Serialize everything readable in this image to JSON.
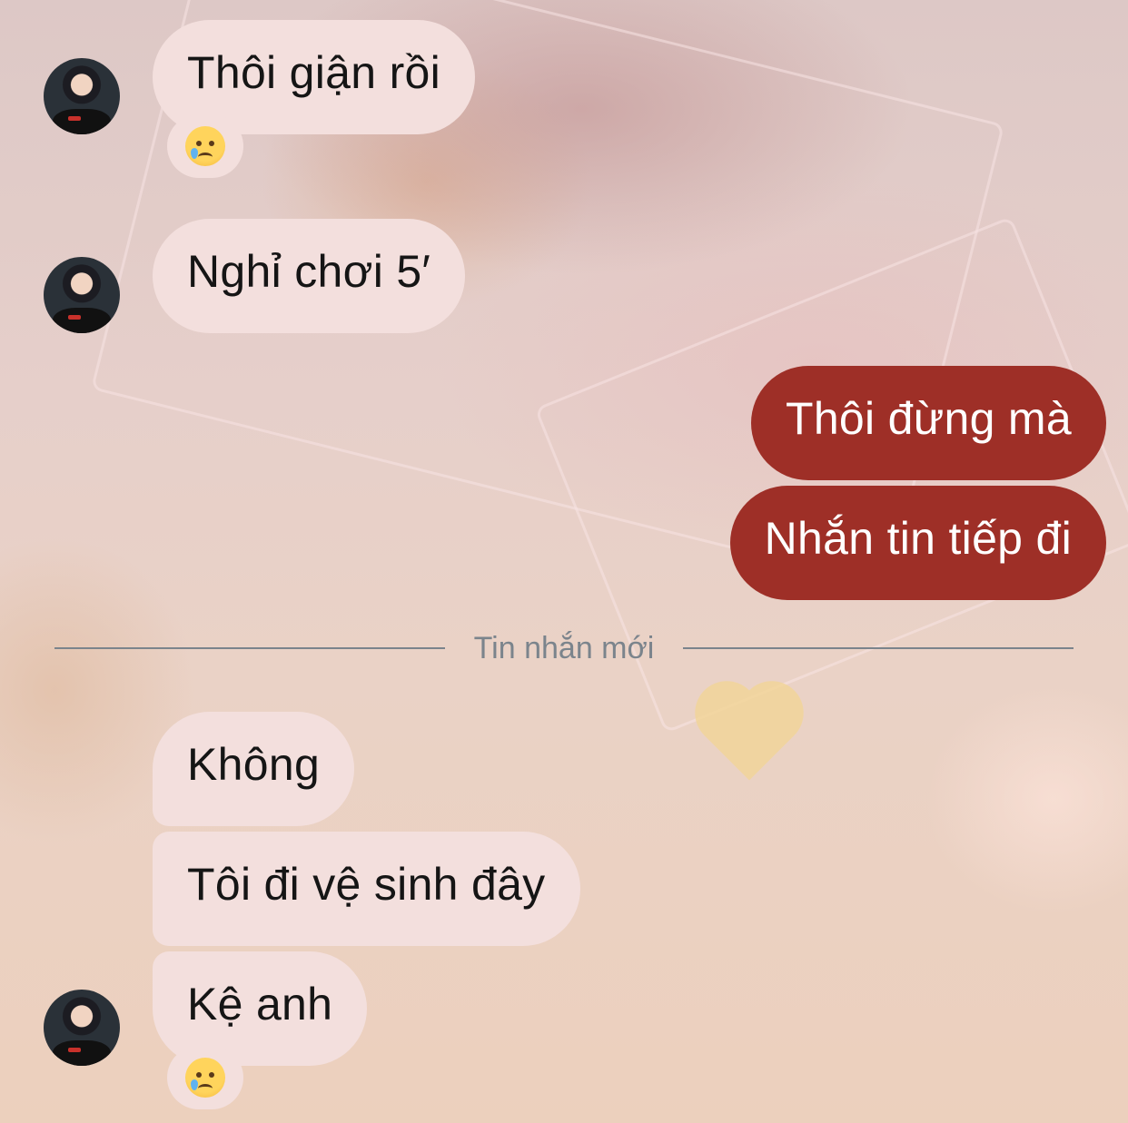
{
  "messages": [
    {
      "text": "Thôi giận rồi",
      "sender": "other",
      "reaction": "crying-face"
    },
    {
      "text": "Nghỉ chơi 5′",
      "sender": "other"
    },
    {
      "text": "Thôi đừng mà",
      "sender": "me"
    },
    {
      "text": "Nhắn tin tiếp đi",
      "sender": "me"
    },
    {
      "text": "Không",
      "sender": "other"
    },
    {
      "text": "Tôi đi vệ sinh đây",
      "sender": "other"
    },
    {
      "text": "Kệ anh",
      "sender": "other",
      "reaction": "crying-face"
    }
  ],
  "divider": {
    "label": "Tin nhắn mới"
  },
  "colors": {
    "incoming_bubble": "#f3dfdd",
    "outgoing_bubble": "#9e2f27",
    "divider": "#7b848c"
  }
}
